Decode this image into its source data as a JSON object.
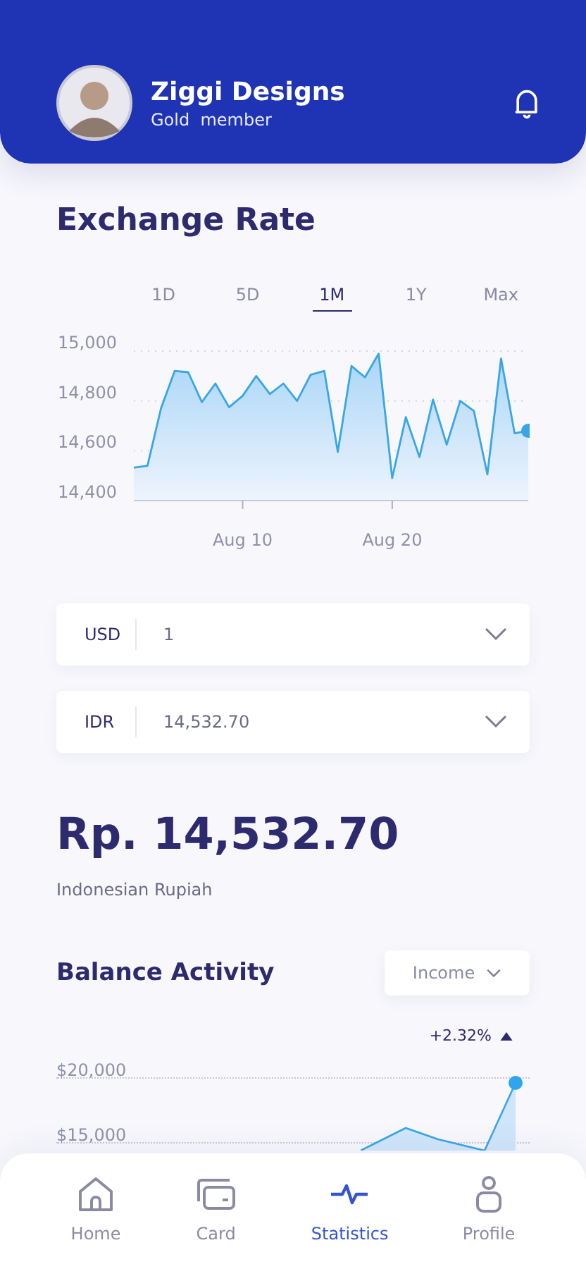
{
  "header": {
    "name": "Ziggi Designs",
    "membership": "Gold  member"
  },
  "exchange": {
    "title": "Exchange Rate",
    "ranges": [
      {
        "label": "1D",
        "selected": false
      },
      {
        "label": "5D",
        "selected": false
      },
      {
        "label": "1M",
        "selected": true
      },
      {
        "label": "1Y",
        "selected": false
      },
      {
        "label": "Max",
        "selected": false
      }
    ],
    "chart_data": {
      "type": "area",
      "categories": [
        null,
        null,
        null,
        null,
        null,
        null,
        null,
        null,
        "Aug 10",
        null,
        null,
        null,
        null,
        null,
        null,
        null,
        null,
        null,
        null,
        "Aug 20",
        null,
        null,
        null,
        null,
        null,
        null,
        null,
        null,
        null,
        null
      ],
      "series": [
        {
          "color": "#3aa6e6",
          "values": [
            14532,
            14540,
            14770,
            14920,
            14915,
            14795,
            14870,
            14775,
            14820,
            14900,
            14828,
            14870,
            14800,
            14905,
            14920,
            14595,
            14940,
            14895,
            14990,
            14490,
            14735,
            14575,
            14805,
            14625,
            14800,
            14760,
            14505,
            14970,
            14670,
            14680
          ]
        }
      ],
      "ylim": [
        14400,
        15000
      ],
      "yticks": [
        {
          "value": 14400,
          "label": "14,400"
        },
        {
          "value": 14600,
          "label": "14,600"
        },
        {
          "value": 14800,
          "label": "14,800"
        },
        {
          "value": 15000,
          "label": "15,000"
        }
      ]
    },
    "currencies": [
      {
        "code": "USD",
        "value": "1"
      },
      {
        "code": "IDR",
        "value": "14,532.70"
      }
    ],
    "amount": "Rp. 14,532.70",
    "currency_name": "Indonesian Rupiah"
  },
  "balance": {
    "title": "Balance Activity",
    "filter": "Income",
    "change": "+2.32%",
    "ticks": [
      "$20,000",
      "$15,000"
    ]
  },
  "nav": [
    {
      "label": "Home",
      "kind": "home",
      "selected": false
    },
    {
      "label": "Card",
      "kind": "card",
      "selected": false
    },
    {
      "label": "Statistics",
      "kind": "stats",
      "selected": true
    },
    {
      "label": "Profile",
      "kind": "profile",
      "selected": false
    }
  ]
}
